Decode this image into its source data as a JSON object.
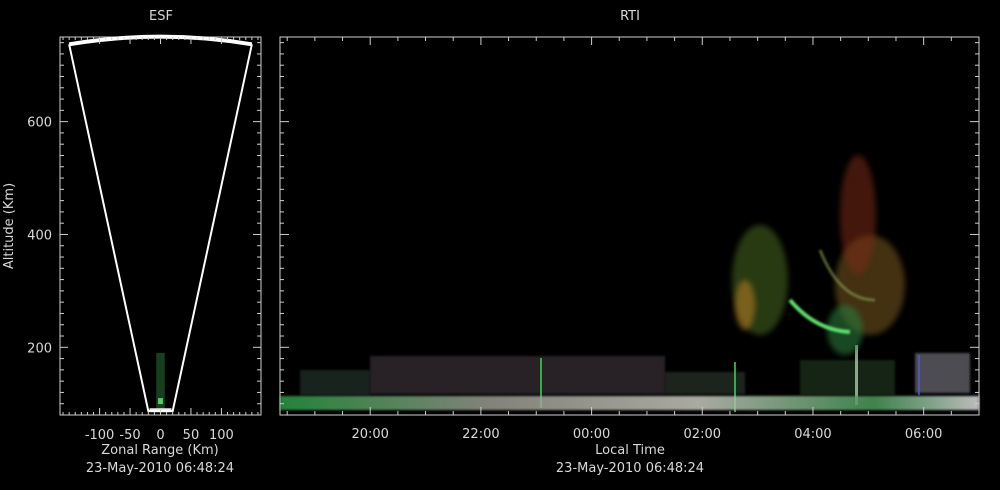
{
  "colors": {
    "background": "#000000",
    "axis": "#cfcfcf",
    "fan": "#ffffff",
    "text": "#d8d8d8"
  },
  "chart_data": [
    {
      "type": "area",
      "title": "ESF",
      "xlabel": "Zonal Range (Km)",
      "ylabel": "Altitude (Km)",
      "timestamp": "23-May-2010 06:48:24",
      "xlim": [
        -165,
        165
      ],
      "ylim": [
        80,
        750
      ],
      "x_ticks": [
        -100,
        -50,
        0,
        50,
        100
      ],
      "y_ticks": [
        200,
        400,
        600
      ],
      "fan": {
        "left_top": [
          -150,
          737
        ],
        "right_top": [
          150,
          737
        ],
        "left_base": [
          -20,
          87
        ],
        "right_base": [
          20,
          87
        ],
        "apex_altitude": 750
      }
    },
    {
      "type": "heatmap",
      "title": "RTI",
      "xlabel": "Local Time",
      "timestamp": "23-May-2010 06:48:24",
      "x_ticks": [
        "20:00",
        "22:00",
        "00:00",
        "02:00",
        "04:00",
        "06:00"
      ],
      "y_ticks": [
        200,
        400,
        600
      ],
      "xlim_hours": [
        18.37,
        31.0
      ],
      "ylim": [
        80,
        750
      ]
    }
  ]
}
